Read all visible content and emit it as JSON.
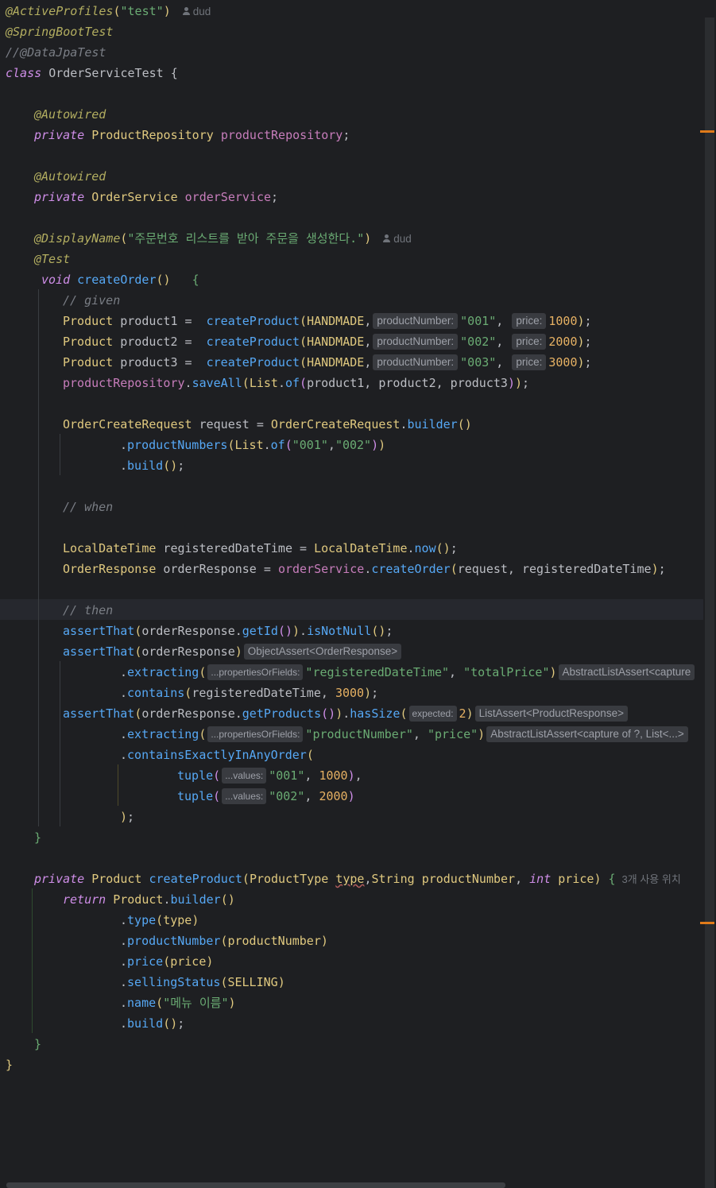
{
  "editor": {
    "author": "dud",
    "hints": {
      "product_number": "productNumber:",
      "price": "price:",
      "properties_or_fields": "...propertiesOrFields:",
      "values": "...values:",
      "expected": "expected:",
      "object_assert": "ObjectAssert<OrderResponse>",
      "abstract_list_assert_1": "AbstractListAssert<capture",
      "list_assert": "ListAssert<ProductResponse>",
      "abstract_list_assert_2": "AbstractListAssert<capture of ?, List<...>"
    },
    "usages": "3개 사용 위치",
    "code": {
      "active_profiles": "\"test\"",
      "comment_datajpa": "//@DataJpaTest",
      "class_name": "OrderServiceTest",
      "display_name": "\"주문번호 리스트를 받아 주문을 생성한다.\"",
      "comment_given": "// given",
      "comment_when": "// when",
      "comment_then": "// then",
      "num_001": "\"001\"",
      "num_002": "\"002\"",
      "num_003": "\"003\"",
      "price_1000": "1000",
      "price_2000": "2000",
      "price_3000": "3000",
      "field_registered": "\"registeredDateTime\"",
      "field_total": "\"totalPrice\"",
      "field_product_number": "\"productNumber\"",
      "field_price": "\"price\"",
      "size_2": "2",
      "menu_name": "\"메뉴 이름\""
    }
  }
}
